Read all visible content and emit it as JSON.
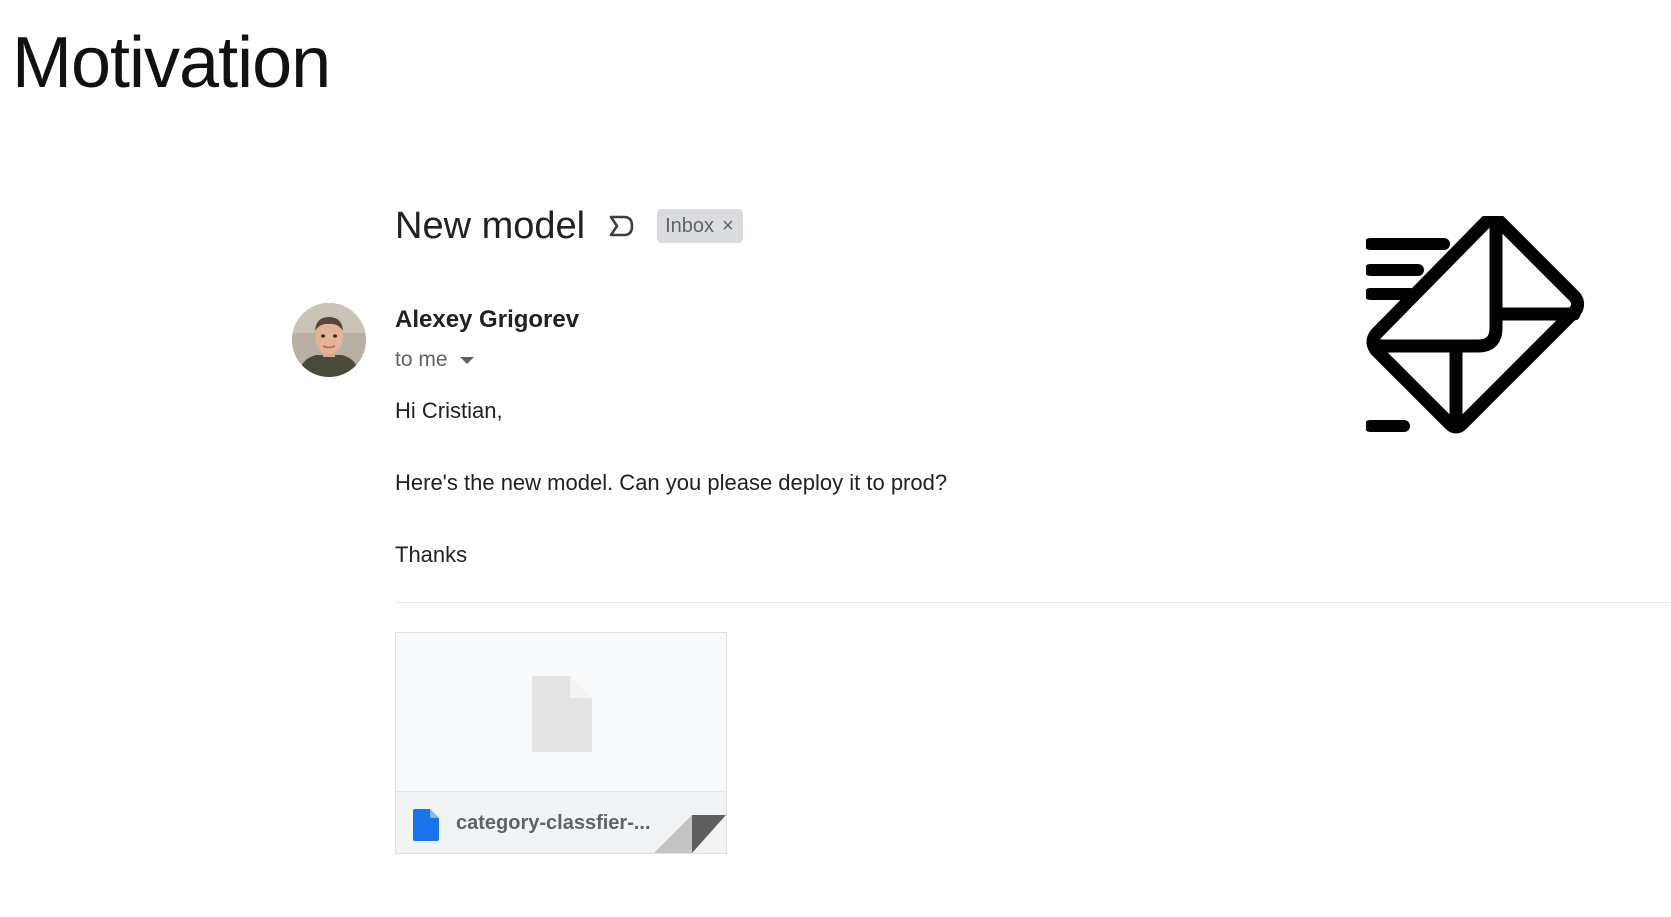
{
  "slide": {
    "title": "Motivation"
  },
  "email": {
    "subject": "New model",
    "label_chip": "Inbox",
    "label_close": "×",
    "sender": "Alexey Grigorev",
    "recipient": "to me",
    "body": {
      "greeting": "Hi Cristian,",
      "message": "Here's the new model. Can you please deploy it to prod?",
      "signoff": "Thanks"
    },
    "attachment": {
      "name": "category-classfier-...",
      "icon": "google-docs-file-icon"
    }
  },
  "icons": {
    "important_marker": "importance-marker-icon",
    "dropdown": "chevron-down-icon",
    "decorative": "fast-mail-envelope-icon"
  },
  "colors": {
    "chip_bg": "#dadce0",
    "doc_blue": "#1a73e8",
    "text_dark": "#202124",
    "text_muted": "#5f6368"
  }
}
